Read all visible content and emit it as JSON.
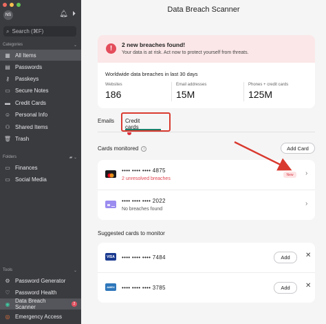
{
  "colors": {
    "sidebar": "#3a3b3f",
    "accent_red": "#e05260",
    "tab_green": "#1a7f6a",
    "annotation_red": "#d93a2f"
  },
  "sidebar": {
    "avatar": "NS",
    "search_placeholder": "Search (⌘F)",
    "categories_label": "Categories",
    "folders_label": "Folders",
    "tools_label": "Tools",
    "items": [
      {
        "label": "All Items",
        "icon": "grid-icon"
      },
      {
        "label": "Passwords",
        "icon": "key-icon"
      },
      {
        "label": "Passkeys",
        "icon": "passkey-icon"
      },
      {
        "label": "Secure Notes",
        "icon": "note-icon"
      },
      {
        "label": "Credit Cards",
        "icon": "card-icon"
      },
      {
        "label": "Personal Info",
        "icon": "person-icon"
      },
      {
        "label": "Shared Items",
        "icon": "people-icon"
      },
      {
        "label": "Trash",
        "icon": "trash-icon"
      }
    ],
    "folders": [
      {
        "label": "Finances",
        "icon": "folder-icon"
      },
      {
        "label": "Social Media",
        "icon": "folder-icon"
      }
    ],
    "tools": [
      {
        "label": "Password Generator",
        "icon": "generator-icon"
      },
      {
        "label": "Password Health",
        "icon": "heart-icon"
      },
      {
        "label": "Data Breach Scanner",
        "icon": "scanner-icon",
        "badge": "2"
      },
      {
        "label": "Emergency Access",
        "icon": "lifebuoy-icon"
      }
    ]
  },
  "main": {
    "title": "Data Breach Scanner",
    "alert": {
      "title": "2 new breaches found!",
      "subtitle": "Your data is at risk. Act now to protect yourself from threats."
    },
    "stats": {
      "heading": "Worldwide data breaches in last 30 days",
      "items": [
        {
          "label": "Websites",
          "value": "186"
        },
        {
          "label": "Email addresses",
          "value": "15M"
        },
        {
          "label": "Phones + credit cards",
          "value": "125M"
        }
      ]
    },
    "tabs": [
      {
        "label": "Emails"
      },
      {
        "label": "Credit cards"
      }
    ],
    "cards_monitored": {
      "title": "Cards monitored",
      "add_label": "Add Card",
      "cards": [
        {
          "number": "•••• •••• •••• 4875",
          "status": "2 unresolved breaches",
          "badge": "New",
          "logo": "mastercard-icon"
        },
        {
          "number": "•••• •••• •••• 2022",
          "status": "No breaches found",
          "logo": "generic-card-icon"
        }
      ]
    },
    "suggested": {
      "title": "Suggested cards to monitor",
      "cards": [
        {
          "number": "•••• •••• •••• 7484",
          "brand": "VISA",
          "add_label": "Add"
        },
        {
          "number": "•••• •••• •••• 3785",
          "brand": "AMEX",
          "add_label": "Add"
        }
      ]
    }
  }
}
